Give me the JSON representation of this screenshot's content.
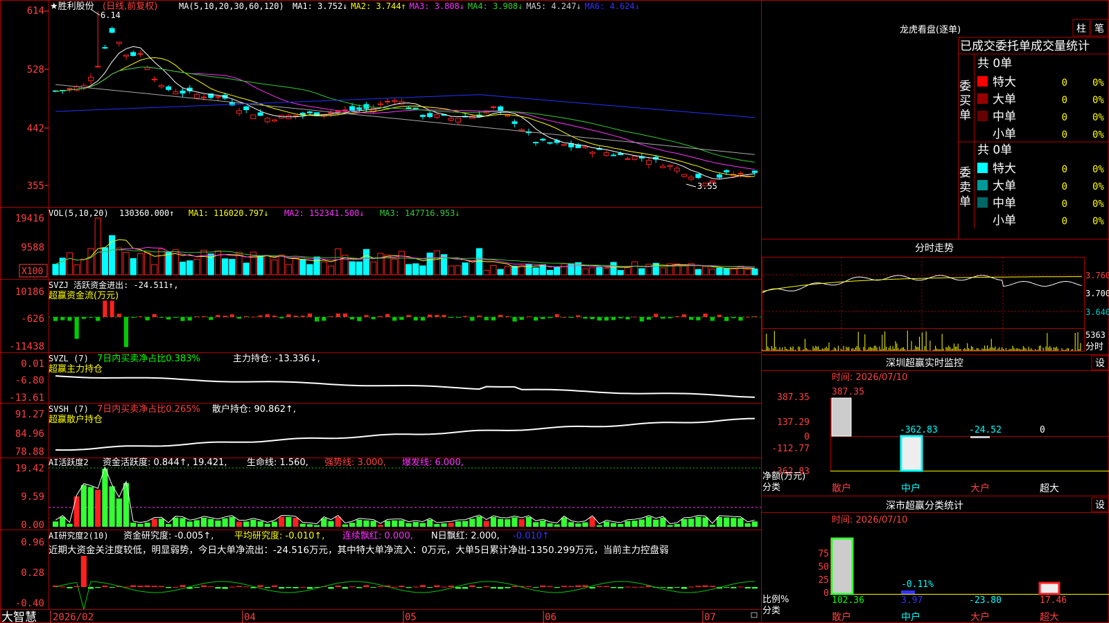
{
  "main_chart": {
    "title": "★胜利股份",
    "period_label": "(日线,前复权)",
    "ma_prefix": "MA(5,10,20,30,60,120)",
    "ma_values": [
      {
        "label": "MA1: 3.752↓",
        "color": "#ffffff"
      },
      {
        "label": "MA2: 3.744↑",
        "color": "#ffff00"
      },
      {
        "label": "MA3: 3.808↓",
        "color": "#ff33ff"
      },
      {
        "label": "MA4: 3.908↓",
        "color": "#33cc33"
      },
      {
        "label": "MA5: 4.247↓",
        "color": "#cccccc"
      },
      {
        "label": "MA6: 4.624↓",
        "color": "#3333ff"
      }
    ],
    "y_ticks": [
      "614",
      "528",
      "442",
      "355"
    ],
    "high_mark": "6.14",
    "low_mark": "3.55"
  },
  "vol_panel": {
    "header": "VOL(5,10,20)",
    "value": "130360.000↑",
    "ma1": "MA1: 116020.797↓",
    "ma2": "MA2: 152341.500↓",
    "ma3": "MA3: 147716.953↓",
    "y_ticks": [
      "19416",
      "9588"
    ],
    "unit": "X100"
  },
  "svzj_panel": {
    "header": "SVZJ  活跃资金进出: -24.511↑,",
    "subtitle": "超赢资金流(万元)",
    "y_ticks": [
      "10186",
      "-626",
      "-11438"
    ]
  },
  "svzl_panel": {
    "prefix": "SVZL (7)",
    "ratio": "7日内买卖净占比0.383%",
    "main": "主力持仓: -13.336↓,",
    "subtitle": "超赢主力持仓",
    "y_ticks": [
      "0.01",
      "-6.80",
      "-13.61"
    ]
  },
  "svsh_panel": {
    "prefix": "SVSH (7)",
    "ratio": "7日内买卖净占比0.265%",
    "main": "散户持仓: 90.862↑,",
    "subtitle": "超赢散户持仓",
    "y_ticks": [
      "91.27",
      "84.96",
      "78.88"
    ]
  },
  "ai_active_panel": {
    "prefix": "AI活跃度2",
    "active": "资金活跃度: 0.844↑, 19.421,",
    "life": "生命线: 1.560,",
    "strong": "强势线: 3.000,",
    "burst": "爆发线: 6.000,",
    "y_ticks": [
      "19.42",
      "9.59",
      "0.00"
    ]
  },
  "ai_research_panel": {
    "prefix": "AI研究度2(10)",
    "research": "资金研究度: -0.005↑,",
    "avg": "平均研究度: -0.010↑,",
    "red": "连续飘红: 0.000,",
    "n_red": "N日飘红: 2.000,",
    "last": "-0.010↑",
    "comment": "近期大资金关注度较低，明显弱势，今日大单净流出：-24.516万元，其中特大单净流入：0万元，大单5日累计净出-1350.299万元，当前主力控盘弱",
    "y_ticks": [
      "0.96",
      "0.28",
      "-0.40"
    ]
  },
  "bottom_bar": {
    "logo": "大智慧",
    "dates": [
      "2026/02",
      "04",
      "05",
      "06",
      "07"
    ]
  },
  "right_panel": {
    "dragon_tiger": {
      "title": "龙虎看盘(逐单)",
      "btn_bar": "柱",
      "btn_pen": "笔",
      "subtitle": "已成交委托单成交量统计",
      "buy_label": "委买单",
      "sell_label": "委卖单",
      "buy_total": "共 0单",
      "sell_total": "共 0单",
      "buy_rows": [
        {
          "label": "特大",
          "value": "0",
          "pct": "0%",
          "color": "#ff0000"
        },
        {
          "label": "大单",
          "value": "0",
          "pct": "0%",
          "color": "#990000"
        },
        {
          "label": "中单",
          "value": "0",
          "pct": "0%",
          "color": "#660000"
        },
        {
          "label": "小单",
          "value": "0",
          "pct": "0%",
          "color": ""
        }
      ],
      "sell_rows": [
        {
          "label": "特大",
          "value": "0",
          "pct": "0%",
          "color": "#00ffff"
        },
        {
          "label": "大单",
          "value": "0",
          "pct": "0%",
          "color": "#009999"
        },
        {
          "label": "中单",
          "value": "0",
          "pct": "0%",
          "color": "#006666"
        },
        {
          "label": "小单",
          "value": "0",
          "pct": "0%",
          "color": ""
        }
      ]
    },
    "timeline": {
      "title": "分时走势",
      "prices": [
        "3.760",
        "3.700",
        "3.640"
      ],
      "vol_label": "5363",
      "tag": "分时"
    },
    "sz_monitor": {
      "title": "深圳超赢实时监控",
      "btn": "设",
      "time": "时间: 2026/07/10",
      "y_ticks": [
        "387.35",
        "137.29",
        "0",
        "-112.77",
        "-362.83"
      ],
      "top_value": "387.35",
      "values": [
        "-362.83",
        "-24.52",
        "0"
      ],
      "unit_label": "净额(万元)",
      "cat_label": "分类",
      "categories": [
        "散户",
        "中户",
        "大户",
        "超大"
      ]
    },
    "sz_class": {
      "title": "深市超赢分类统计",
      "btn": "设",
      "time": "时间: 2026/07/10",
      "y_ticks": [
        "75",
        "50",
        "25",
        "0"
      ],
      "top_value": "-0.11%",
      "values": [
        "102.36",
        "3.97",
        "-23.80",
        "17.46"
      ],
      "unit_label": "比例%",
      "cat_label": "分类",
      "categories": [
        "散户",
        "中户",
        "大户",
        "超大"
      ]
    }
  },
  "colors": {
    "grid": "#b00000",
    "up": "#ff2020",
    "down": "#00ffff",
    "bg": "#000000",
    "label": "#ff4040"
  }
}
